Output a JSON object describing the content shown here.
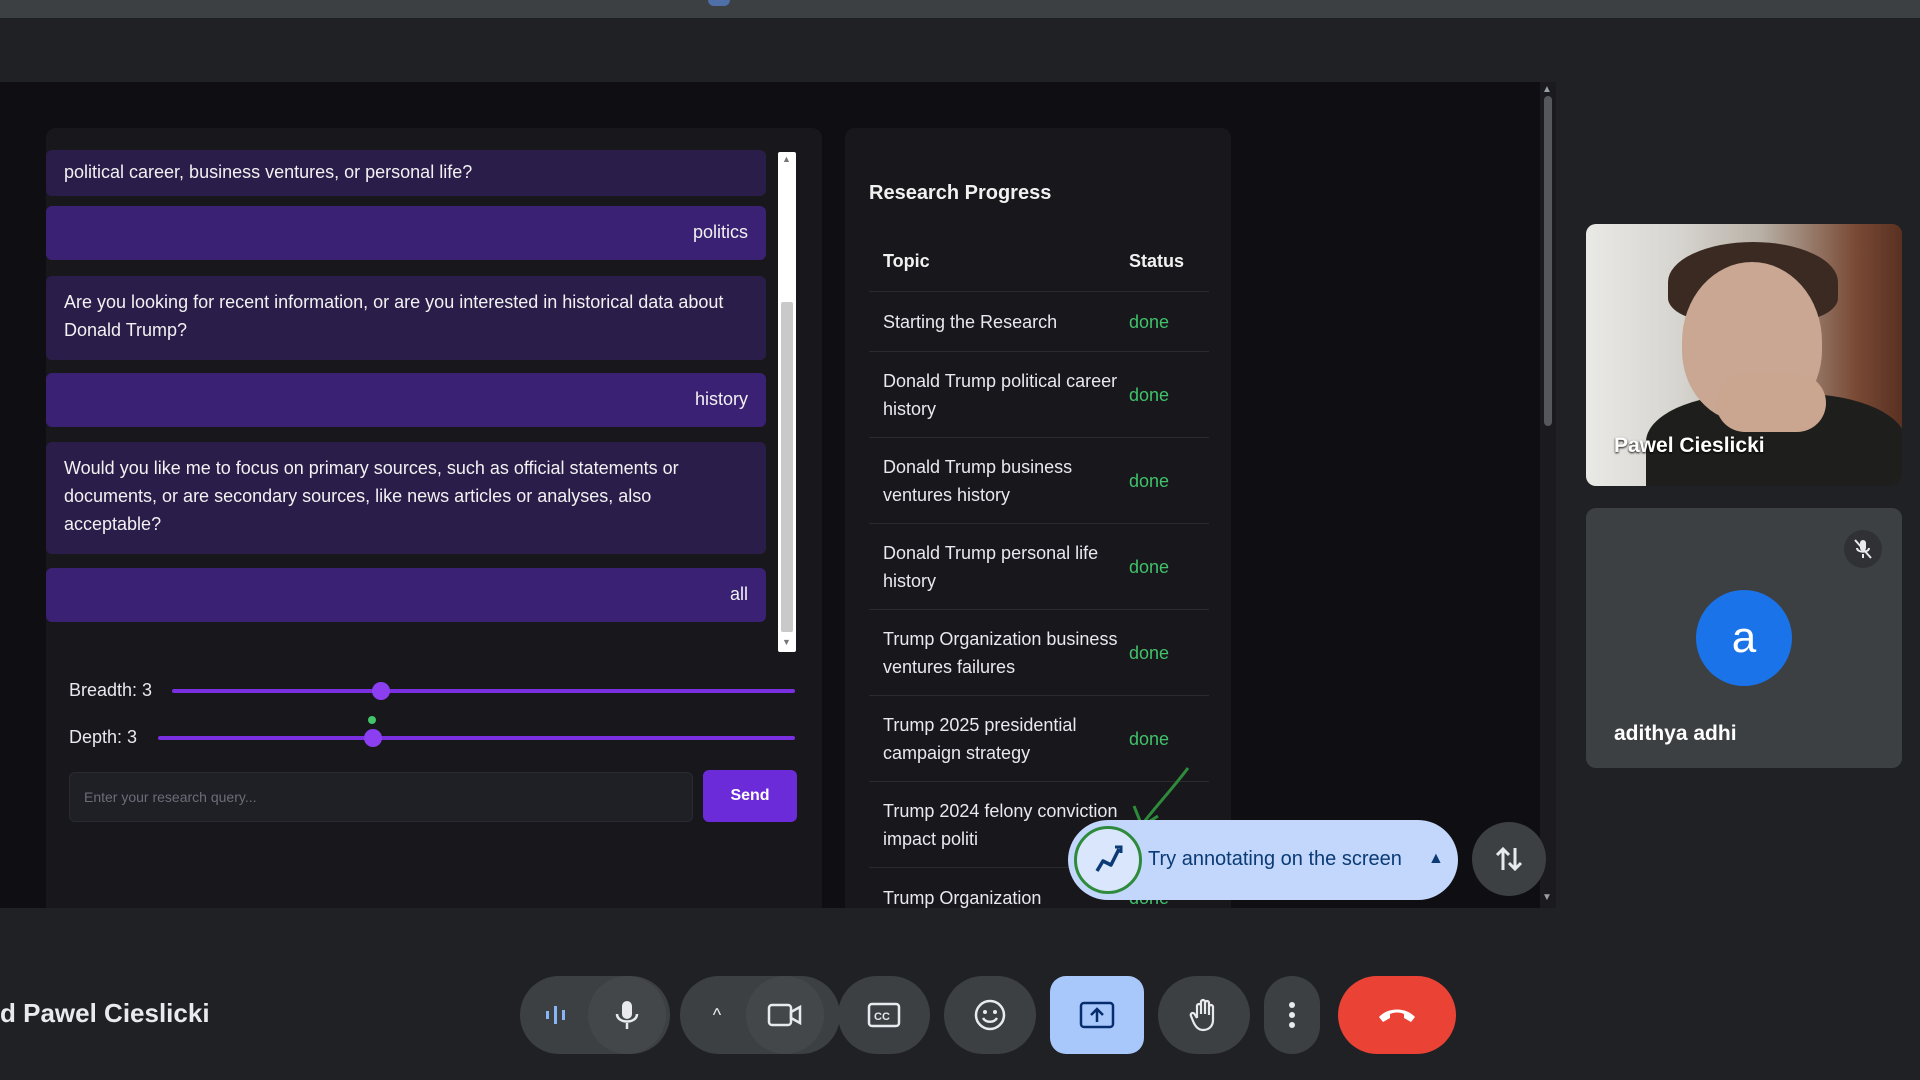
{
  "meeting": {
    "title": "d Pawel Cieslicki"
  },
  "chat": {
    "messages": [
      {
        "role": "bot",
        "text": "political career, business ventures, or personal life?"
      },
      {
        "role": "user",
        "text": "politics"
      },
      {
        "role": "bot",
        "text": "Are you looking for recent information, or are you interested in historical data about Donald Trump?"
      },
      {
        "role": "user",
        "text": "history"
      },
      {
        "role": "bot",
        "text": "Would you like me to focus on primary sources, such as official statements or documents, or are secondary sources, like news articles or analyses, also acceptable?"
      },
      {
        "role": "user",
        "text": "all"
      }
    ],
    "breadth_label": "Breadth: 3",
    "depth_label": "Depth: 3",
    "breadth_value": 3,
    "depth_value": 3,
    "input_placeholder": "Enter your research query...",
    "send_label": "Send"
  },
  "progress": {
    "title": "Research Progress",
    "headers": {
      "topic": "Topic",
      "status": "Status"
    },
    "rows": [
      {
        "topic": "Starting the Research",
        "status": "done"
      },
      {
        "topic": "Donald Trump political career history",
        "status": "done"
      },
      {
        "topic": "Donald Trump business ventures history",
        "status": "done"
      },
      {
        "topic": "Donald Trump personal life history",
        "status": "done"
      },
      {
        "topic": "Trump Organization business ventures failures",
        "status": "done"
      },
      {
        "topic": "Trump 2025 presidential campaign strategy",
        "status": "done"
      },
      {
        "topic": "Trump 2024 felony conviction impact politi",
        "status": ""
      },
      {
        "topic": "Trump Organization",
        "status": "done"
      }
    ]
  },
  "annotation": {
    "text": "Try annotating on the screen"
  },
  "participants": [
    {
      "name": "Pawel Cieslicki",
      "type": "video"
    },
    {
      "name": "adithya adhi",
      "type": "audio",
      "initial": "a",
      "muted": true
    }
  ],
  "colors": {
    "accent_purple": "#6c2bd9",
    "done_green": "#41c16a",
    "hangup_red": "#ea4335",
    "active_blue": "#a8c7fa"
  },
  "controls": [
    "audio-levels-icon",
    "mic-icon",
    "chevron-up-icon",
    "camera-icon",
    "captions-icon",
    "emoji-icon",
    "present-icon",
    "raise-hand-icon",
    "more-icon",
    "hangup-icon"
  ]
}
